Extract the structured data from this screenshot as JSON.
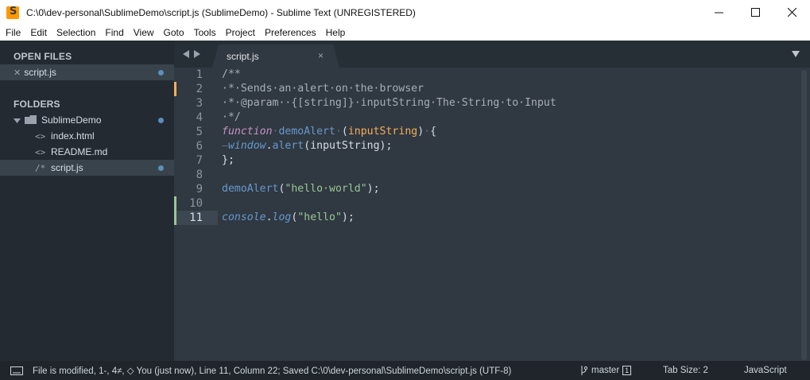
{
  "window": {
    "title": "C:\\0\\dev-personal\\SublimeDemo\\script.js (SublimeDemo) - Sublime Text (UNREGISTERED)"
  },
  "menu": [
    "File",
    "Edit",
    "Selection",
    "Find",
    "View",
    "Goto",
    "Tools",
    "Project",
    "Preferences",
    "Help"
  ],
  "sidebar": {
    "open_files_label": "OPEN FILES",
    "open_files": [
      {
        "name": "script.js",
        "icon": "close-icon",
        "modified": true
      }
    ],
    "folders_label": "FOLDERS",
    "folder": {
      "name": "SublimeDemo",
      "modified": true
    },
    "files": [
      {
        "name": "index.html",
        "icon": "<>",
        "selected": false,
        "modified": false
      },
      {
        "name": "README.md",
        "icon": "<>",
        "selected": false,
        "modified": false
      },
      {
        "name": "script.js",
        "icon": "/*",
        "selected": true,
        "modified": true
      }
    ]
  },
  "tabs": [
    {
      "label": "script.js",
      "close": "×"
    }
  ],
  "editor": {
    "line_numbers": [
      "1",
      "2",
      "3",
      "4",
      "5",
      "6",
      "7",
      "8",
      "9",
      "10",
      "11"
    ],
    "current_line": 11,
    "lines": [
      [
        [
          "/**",
          "#a7adba"
        ]
      ],
      [
        [
          "·*·Sends·an·alert·on·the·browser",
          "#a7adba"
        ]
      ],
      [
        [
          "·*·@param··{[string]}·inputString·The·String·to·Input",
          "#a7adba"
        ]
      ],
      [
        [
          "·*/",
          "#a7adba"
        ]
      ],
      [
        [
          "function",
          "#c594c5",
          "i"
        ],
        [
          "·",
          "#65737e"
        ],
        [
          "demoAlert",
          "#6699cc"
        ],
        [
          "·",
          "#65737e"
        ],
        [
          "(",
          "#d8dee9"
        ],
        [
          "inputString",
          "#f9ae58"
        ],
        [
          ")",
          "#d8dee9"
        ],
        [
          "·",
          "#65737e"
        ],
        [
          "{",
          "#d8dee9"
        ]
      ],
      [
        [
          "—",
          "#65737e"
        ],
        [
          "window",
          "#6699cc",
          "i"
        ],
        [
          ".",
          "#d8dee9"
        ],
        [
          "alert",
          "#6699cc"
        ],
        [
          "(inputString);",
          "#d8dee9"
        ]
      ],
      [
        [
          "};",
          "#d8dee9"
        ]
      ],
      [
        [
          "",
          "#d8dee9"
        ]
      ],
      [
        [
          "demoAlert",
          "#6699cc"
        ],
        [
          "(",
          "#d8dee9"
        ],
        [
          "\"hello·world\"",
          "#99c794"
        ],
        [
          ");",
          "#d8dee9"
        ]
      ],
      [
        [
          "",
          "#d8dee9"
        ]
      ],
      [
        [
          "console",
          "#6699cc",
          "i"
        ],
        [
          ".",
          "#d8dee9"
        ],
        [
          "log",
          "#6699cc",
          "i"
        ],
        [
          "(",
          "#d8dee9"
        ],
        [
          "\"hello\"",
          "#99c794"
        ],
        [
          ");",
          "#d8dee9"
        ]
      ]
    ],
    "markers": [
      {
        "line": 2,
        "color": "#f9ae58"
      },
      {
        "line": 10,
        "color": "#99c794"
      },
      {
        "line": 11,
        "color": "#99c794"
      }
    ]
  },
  "status": {
    "message": "File is modified, 1-, 4≠, ◇ You (just now), Line 11, Column 22; Saved C:\\0\\dev-personal\\SublimeDemo\\script.js (UTF-8)",
    "branch": "master",
    "branch_badge": "1",
    "tab_size": "Tab Size: 2",
    "syntax": "JavaScript"
  }
}
